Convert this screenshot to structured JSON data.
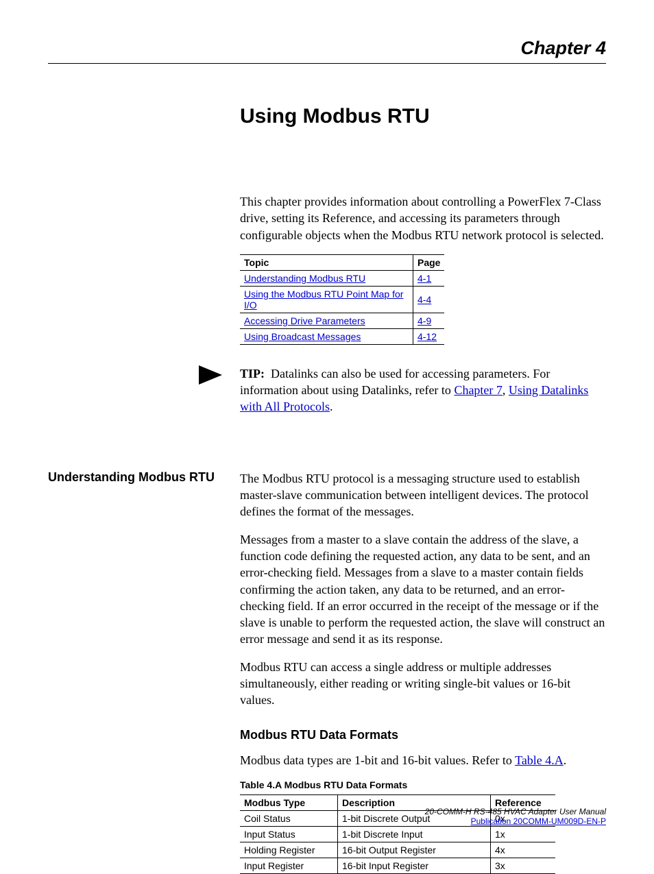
{
  "chapter_label": "Chapter 4",
  "page_title": "Using Modbus RTU",
  "intro": "This chapter provides information about controlling a PowerFlex 7-Class drive, setting its Reference, and accessing its parameters through configurable objects when the Modbus RTU network protocol is selected.",
  "toc": {
    "header_topic": "Topic",
    "header_page": "Page",
    "rows": [
      {
        "topic": "Understanding Modbus RTU",
        "page": "4-1"
      },
      {
        "topic": "Using the Modbus RTU Point Map for I/O",
        "page": "4-4"
      },
      {
        "topic": "Accessing Drive Parameters",
        "page": "4-9"
      },
      {
        "topic": "Using Broadcast Messages",
        "page": "4-12"
      }
    ]
  },
  "tip": {
    "label": "TIP:",
    "text_before": "Datalinks can also be used for accessing parameters. For information about using Datalinks, refer to ",
    "link1": "Chapter 7",
    "sep": ", ",
    "link2": "Using Datalinks with All Protocols",
    "after": "."
  },
  "section1": {
    "title": "Understanding Modbus RTU",
    "para1": "The Modbus RTU protocol is a messaging structure used to establish master-slave communication between intelligent devices. The protocol defines the format of the messages.",
    "para2": "Messages from a master to a slave contain the address of the slave, a function code defining the requested action, any data to be sent, and an error-checking field. Messages from a slave to a master contain fields confirming the action taken, any data to be returned, and an error-checking field. If an error occurred in the receipt of the message or if the slave is unable to perform the requested action, the slave will construct an error message and send it as its response.",
    "para3": "Modbus RTU can access a single address or multiple addresses simultaneously, either reading or writing single-bit values or 16-bit values."
  },
  "section2": {
    "title": "Modbus RTU Data Formats",
    "intro_before": "Modbus data types are 1-bit and 16-bit values. Refer to ",
    "intro_link": "Table 4.A",
    "intro_after": ".",
    "caption": "Table 4.A   Modbus RTU Data Formats",
    "headers": {
      "type": "Modbus Type",
      "desc": "Description",
      "ref": "Reference"
    },
    "rows": [
      {
        "type": "Coil Status",
        "desc": "1-bit Discrete Output",
        "ref": "0x"
      },
      {
        "type": "Input Status",
        "desc": "1-bit Discrete Input",
        "ref": "1x"
      },
      {
        "type": "Holding Register",
        "desc": "16-bit Output Register",
        "ref": "4x"
      },
      {
        "type": "Input Register",
        "desc": "16-bit Input Register",
        "ref": "3x"
      }
    ]
  },
  "footer": {
    "line1": "20-COMM-H RS-485 HVAC Adapter User Manual",
    "line2": "Publication 20COMM-UM009D-EN-P"
  },
  "chart_data": {
    "type": "table",
    "title": "Table 4.A Modbus RTU Data Formats",
    "columns": [
      "Modbus Type",
      "Description",
      "Reference"
    ],
    "rows": [
      [
        "Coil Status",
        "1-bit Discrete Output",
        "0x"
      ],
      [
        "Input Status",
        "1-bit Discrete Input",
        "1x"
      ],
      [
        "Holding Register",
        "16-bit Output Register",
        "4x"
      ],
      [
        "Input Register",
        "16-bit Input Register",
        "3x"
      ]
    ]
  }
}
